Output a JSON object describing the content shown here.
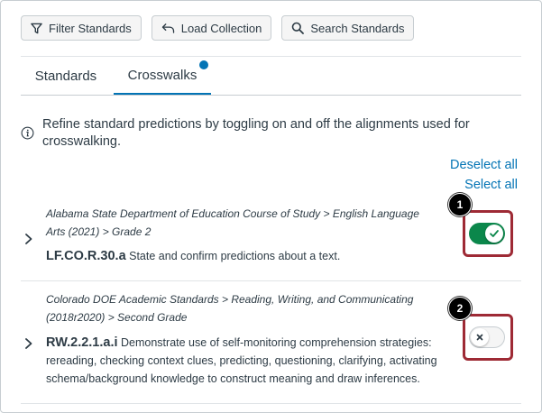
{
  "toolbar": {
    "filter_label": "Filter Standards",
    "load_label": "Load Collection",
    "search_label": "Search Standards"
  },
  "tabs": [
    {
      "label": "Standards",
      "selected": false
    },
    {
      "label": "Crosswalks",
      "selected": true
    }
  ],
  "info": {
    "text": "Refine standard predictions by toggling on and off the alignments used for crosswalking."
  },
  "links": {
    "deselect_all": "Deselect all",
    "select_all": "Select all"
  },
  "rows": [
    {
      "path": "Alabama State Department of Education Course of Study > English Language Arts (2021) > Grade 2",
      "code": "LF.CO.R.30.a",
      "description": "State and confirm predictions about a text.",
      "enabled": true,
      "callout": "1"
    },
    {
      "path": "Colorado DOE Academic Standards > Reading, Writing, and Communicating (2018r2020) > Second Grade",
      "code": "RW.2.2.1.a.i",
      "description": "Demonstrate use of self-monitoring comprehension strategies: rereading, checking context clues, predicting, questioning, clarifying, activating schema/background knowledge to construct meaning and draw inferences.",
      "enabled": false,
      "callout": "2"
    }
  ],
  "colors": {
    "accent": "#0374b5",
    "toggle_on": "#0b874b",
    "highlight": "#9e2a35"
  }
}
